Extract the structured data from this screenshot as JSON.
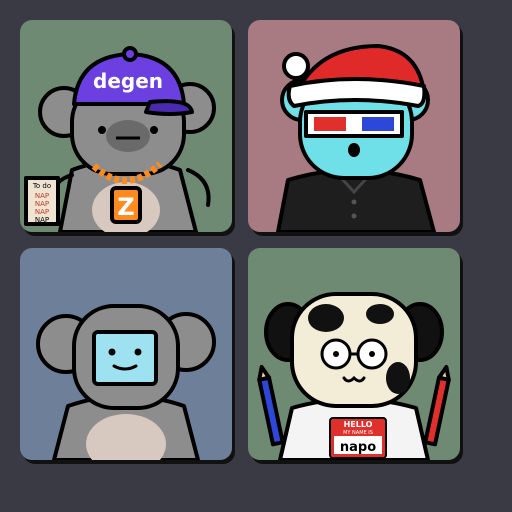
{
  "tiles": [
    {
      "character": "koala",
      "background": "#6e8a72",
      "accessories": [
        "cap-icon",
        "chain-icon",
        "todo-note-icon"
      ],
      "cap_text": "degen",
      "pendant_letter": "Z",
      "note": {
        "title": "To do",
        "lines": [
          "NAP",
          "NAP",
          "NAP",
          "NAP"
        ]
      }
    },
    {
      "character": "bear",
      "background": "#a87a82",
      "accessories": [
        "santa-hat-icon",
        "3d-glasses-icon",
        "black-shirt-icon"
      ]
    },
    {
      "character": "koala",
      "background": "#6e7f9a",
      "accessories": [
        "face-monitor-icon"
      ]
    },
    {
      "character": "dalmatian",
      "background": "#6e8a72",
      "accessories": [
        "round-glasses-icon",
        "pencil-icon",
        "name-tag-icon"
      ],
      "name_tag": {
        "hello": "HELLO",
        "subtitle": "MY NAME IS",
        "name": "napo"
      }
    }
  ]
}
